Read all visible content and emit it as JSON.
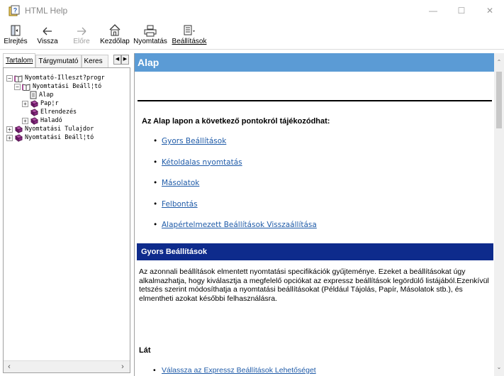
{
  "window": {
    "title": "HTML Help",
    "minimize": "—",
    "maximize": "☐",
    "close": "✕"
  },
  "toolbar": {
    "hide": "Elrejtés",
    "back": "Vissza",
    "forward": "Előre",
    "home": "Kezdőlap",
    "print": "Nyomtatás",
    "options": "Beállítások"
  },
  "tabs": {
    "contents": "Tartalom",
    "index": "Tárgymutató",
    "search": "Keres"
  },
  "tree": {
    "items": [
      {
        "label": "Nyomtató-Illeszt?progr",
        "level": 0,
        "expander": "−",
        "icon": "open-book-icon"
      },
      {
        "label": "Nyomtatási Beáll¦tó",
        "level": 1,
        "expander": "−",
        "icon": "open-book-icon"
      },
      {
        "label": "Alap",
        "level": 2,
        "expander": "",
        "icon": "page-icon"
      },
      {
        "label": "Pap¦r",
        "level": 2,
        "expander": "+",
        "icon": "closed-book-icon"
      },
      {
        "label": "Elrendezés",
        "level": 2,
        "expander": "",
        "icon": "closed-book-icon"
      },
      {
        "label": "Haladó",
        "level": 2,
        "expander": "+",
        "icon": "closed-book-icon"
      },
      {
        "label": "Nyomtatási Tulajdor",
        "level": 0,
        "expander": "+",
        "icon": "closed-book-icon"
      },
      {
        "label": "Nyomtatási Beáll¦tó",
        "level": 0,
        "expander": "+",
        "icon": "closed-book-icon"
      }
    ]
  },
  "content": {
    "header": "Alap",
    "lead": "Az Alap lapon a következő pontokról tájékozódhat:",
    "links": [
      "Gyors Beállítások",
      "Kétoldalas nyomtatás",
      "Másolatok",
      "Felbontás",
      "Alapértelmezett Beállítások Visszaállítása"
    ],
    "section_title": "Gyors Beállítások",
    "paragraph": "Az azonnali beállítások elmentett nyomtatási specifikációk gyűjteménye. Ezeket a beállításokat úgy alkalmazhatja, hogy kiválasztja a megfelelő opciókat az expressz beállítások legördülő listájából.Ezenkívül tetszés szerint módosíthatja a nyomtatási beállításokat (Például Tájolás, Papír, Másolatok stb.), és elmentheti azokat későbbi felhasználásra.",
    "lat_title": "Lát",
    "lat_link": "Válassza az Expressz Beállítások Lehetőséget"
  },
  "colors": {
    "header_bg": "#5b9bd5",
    "section_bg": "#0e2b8c",
    "link": "#1f5ba8"
  }
}
